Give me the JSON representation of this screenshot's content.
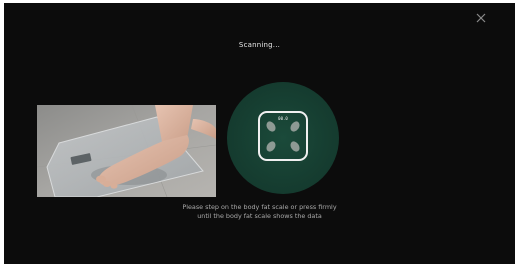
{
  "dialog": {
    "title": "Scanning...",
    "close_icon": "close-icon"
  },
  "illustration": {
    "photo_icon": "foot-on-scale-photo",
    "scale_icon": "body-fat-scale-icon",
    "scale_reading": "00.0",
    "accent_color": "#1b4a3a"
  },
  "instructions": {
    "line1": "Please step on the body fat scale or press firmly",
    "line2": "until the body fat scale shows the data"
  }
}
